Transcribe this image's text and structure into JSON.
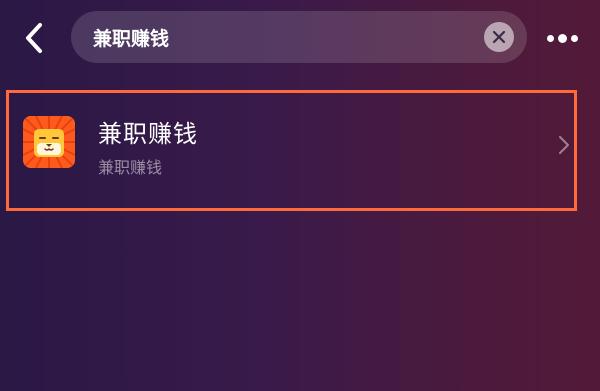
{
  "header": {
    "back_icon": "chevron-left-icon",
    "search": {
      "value": "兼职赚钱",
      "placeholder": ""
    },
    "clear_icon": "close-icon",
    "more_icon": "more-dots-icon"
  },
  "results": [
    {
      "title": "兼职赚钱",
      "subtitle": "兼职赚钱",
      "icon": "lion-app-icon",
      "chevron_icon": "chevron-right-icon"
    }
  ],
  "colors": {
    "highlight_border": "#ff6a3d",
    "icon_orange": "#ff5a1e",
    "icon_yellow": "#ffc83a",
    "background_left": "#2a1845",
    "background_right": "#531a38"
  }
}
